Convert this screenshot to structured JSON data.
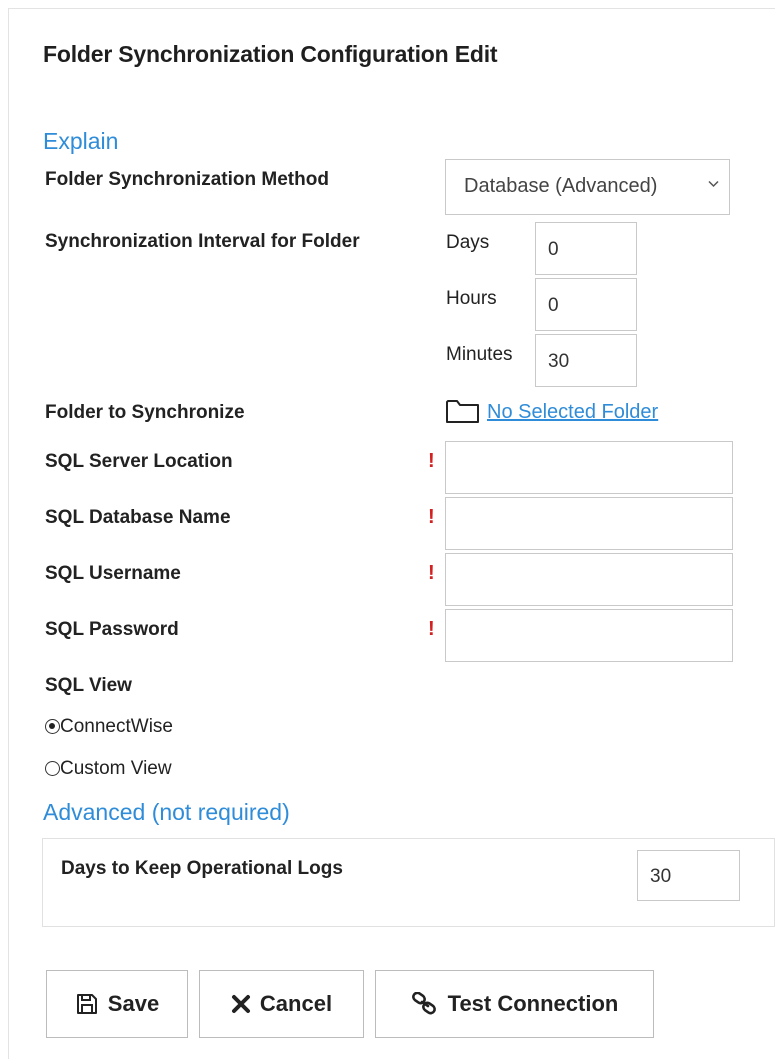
{
  "page": {
    "title": "Folder Synchronization Configuration Edit",
    "explain_link": "Explain",
    "advanced_header": "Advanced (not required)"
  },
  "form": {
    "sync_method": {
      "label": "Folder Synchronization Method",
      "selected": "Database (Advanced)"
    },
    "interval": {
      "label": "Synchronization Interval for Folder",
      "days_label": "Days",
      "days_value": "0",
      "hours_label": "Hours",
      "hours_value": "0",
      "minutes_label": "Minutes",
      "minutes_value": "30"
    },
    "folder": {
      "label": "Folder to Synchronize",
      "link": "No Selected Folder",
      "icon": "folder-icon"
    },
    "sql_server": {
      "label": "SQL Server Location",
      "required": "!",
      "value": ""
    },
    "sql_database": {
      "label": "SQL Database Name",
      "required": "!",
      "value": ""
    },
    "sql_username": {
      "label": "SQL Username",
      "required": "!",
      "value": ""
    },
    "sql_password": {
      "label": "SQL Password",
      "required": "!",
      "value": ""
    },
    "sql_view": {
      "label": "SQL View",
      "options": [
        "ConnectWise",
        "Custom View"
      ],
      "selected": "ConnectWise"
    },
    "advanced": {
      "log_days_label": "Days to Keep Operational Logs",
      "log_days_value": "30"
    }
  },
  "buttons": {
    "save": {
      "label": "Save",
      "icon": "save-icon"
    },
    "cancel": {
      "label": "Cancel",
      "icon": "x-icon"
    },
    "test": {
      "label": "Test Connection",
      "icon": "link-icon"
    }
  },
  "colors": {
    "link": "#2f8cd8",
    "required": "#d42020",
    "border": "#c9c9c9"
  }
}
